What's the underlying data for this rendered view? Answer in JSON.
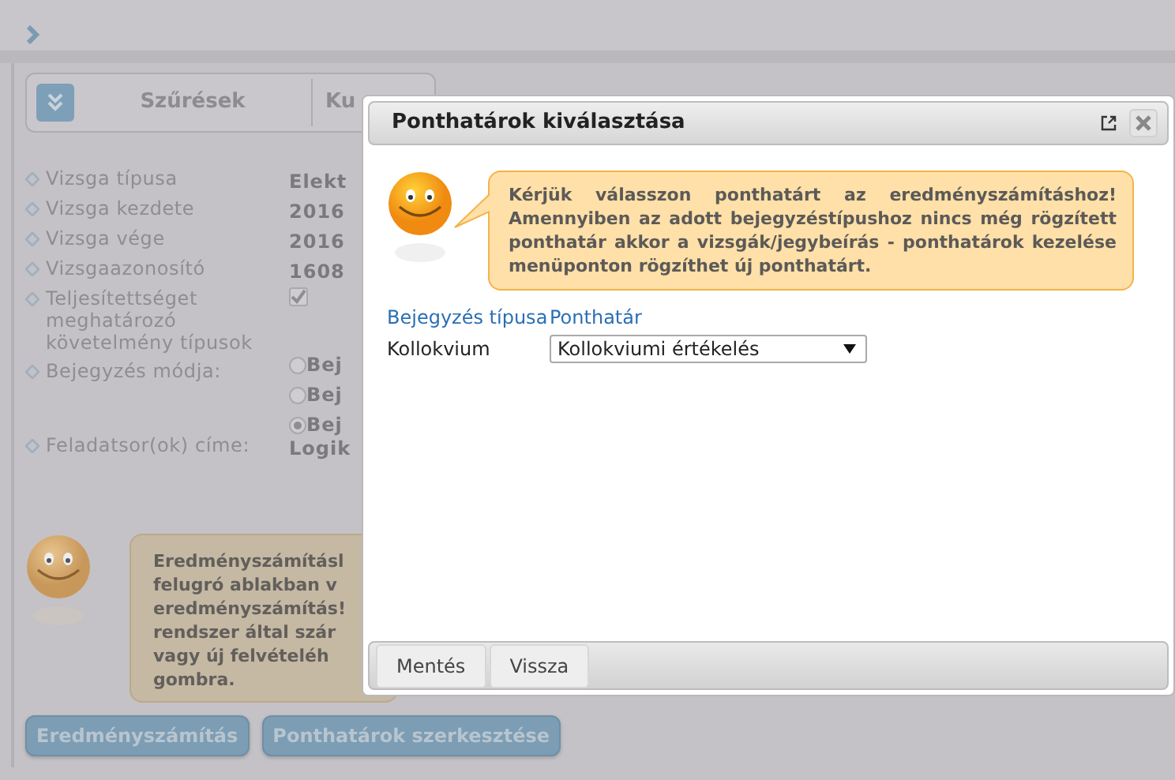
{
  "filter_bar": {
    "title": "Szűrések",
    "tab_2": "Ku"
  },
  "details": [
    {
      "kind": "text",
      "label": "Vizsga típusa",
      "value": "Elekt"
    },
    {
      "kind": "text",
      "label": "Vizsga kezdete",
      "value": "2016"
    },
    {
      "kind": "text",
      "label": "Vizsga vége",
      "value": "2016"
    },
    {
      "kind": "text",
      "label": "Vizsgaazonosító",
      "value": "1608"
    },
    {
      "kind": "checkbox",
      "label": "Teljesítettséget meghatározó követelmény típusok",
      "checked": true
    },
    {
      "kind": "radio",
      "label": "Bejegyzés módja:",
      "options": [
        {
          "label": "Bej",
          "selected": false
        },
        {
          "label": "Bej",
          "selected": false
        },
        {
          "label": "Bej",
          "selected": true
        }
      ]
    },
    {
      "kind": "text",
      "label": "Feladatsor(ok) címe:",
      "value": "Logik"
    }
  ],
  "info_bubble": {
    "lines": [
      "Eredményszámításl",
      "felugró ablakban v",
      "eredményszámítás!",
      "rendszer által szár",
      "vagy új felvételéh",
      "gombra."
    ]
  },
  "buttons": [
    "Eredményszámítás",
    "Ponthatárok szerkesztése"
  ],
  "dialog": {
    "title": "Ponthatárok kiválasztása",
    "message": "Kérjük válasszon ponthatárt az eredményszámításhoz! Amennyiben az adott bejegyzéstípushoz nincs még rögzített ponthatár akkor a vizsgák/jegybeírás - ponthatárok kezelése menüponton rögzíthet új ponthatárt.",
    "columns": [
      "Bejegyzés típusa",
      "Ponthatár"
    ],
    "rows": [
      {
        "type": "Kollokvium",
        "value": "Kollokviumi értékelés"
      }
    ],
    "buttons": [
      "Mentés",
      "Vissza"
    ]
  }
}
